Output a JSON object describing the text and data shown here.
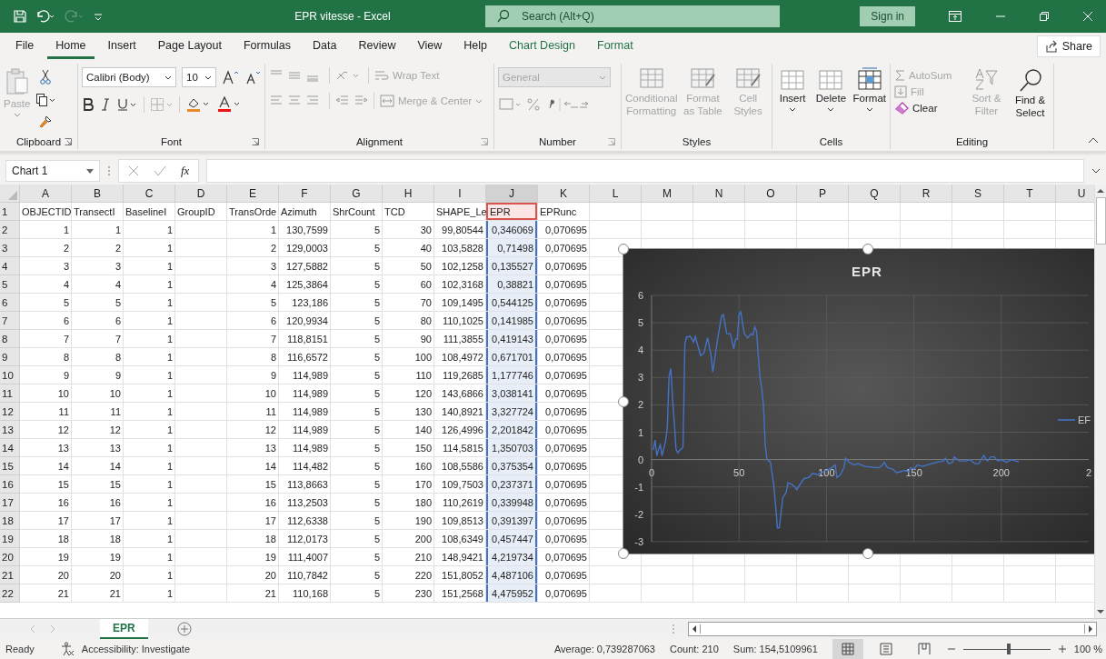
{
  "window": {
    "title": "EPR vitesse  -  Excel",
    "search": {
      "placeholder": "Search (Alt+Q)"
    },
    "sign_in": "Sign in"
  },
  "menu": [
    {
      "label": "File",
      "selected": false,
      "kind": "plain"
    },
    {
      "label": "Home",
      "selected": true,
      "kind": "plain"
    },
    {
      "label": "Insert",
      "selected": false,
      "kind": "plain"
    },
    {
      "label": "Page Layout",
      "selected": false,
      "kind": "plain"
    },
    {
      "label": "Formulas",
      "selected": false,
      "kind": "plain"
    },
    {
      "label": "Data",
      "selected": false,
      "kind": "plain"
    },
    {
      "label": "Review",
      "selected": false,
      "kind": "plain"
    },
    {
      "label": "View",
      "selected": false,
      "kind": "plain"
    },
    {
      "label": "Help",
      "selected": false,
      "kind": "plain"
    },
    {
      "label": "Chart Design",
      "selected": false,
      "kind": "contextual"
    },
    {
      "label": "Format",
      "selected": false,
      "kind": "contextual"
    }
  ],
  "share": "Share",
  "ribbon": {
    "clipboard": {
      "label": "Clipboard",
      "paste": {
        "label": "Paste",
        "disabled": true
      }
    },
    "font": {
      "label": "Font",
      "family": "Calibri (Body)",
      "size": "10"
    },
    "alignment": {
      "label": "Alignment",
      "wrap_text": {
        "label": "Wrap Text",
        "disabled": true
      },
      "merge_center": {
        "label": "Merge & Center",
        "disabled": true
      }
    },
    "number": {
      "label": "Number",
      "format": {
        "value": "General",
        "disabled": true
      }
    },
    "styles": {
      "label": "Styles",
      "buttons": [
        {
          "label": "Conditional Formatting",
          "disabled": true
        },
        {
          "label": "Format as Table",
          "disabled": true
        },
        {
          "label": "Cell Styles",
          "disabled": true
        }
      ]
    },
    "cells": {
      "label": "Cells",
      "buttons": [
        {
          "label": "Insert",
          "disabled": false
        },
        {
          "label": "Delete",
          "disabled": false
        },
        {
          "label": "Format",
          "disabled": false
        }
      ]
    },
    "editing": {
      "label": "Editing",
      "autosum": {
        "label": "AutoSum",
        "disabled": true
      },
      "fill": {
        "label": "Fill",
        "disabled": true
      },
      "clear": {
        "label": "Clear",
        "disabled": false
      },
      "sort_filter": {
        "label": "Sort & Filter",
        "disabled": true
      },
      "find_select": {
        "label": "Find & Select",
        "disabled": false
      }
    }
  },
  "formula_bar": {
    "name_box": "Chart 1",
    "fx": "fx"
  },
  "table": {
    "columns": [
      {
        "label": "A",
        "highlighted": false
      },
      {
        "label": "B",
        "highlighted": false
      },
      {
        "label": "C",
        "highlighted": false
      },
      {
        "label": "D",
        "highlighted": false
      },
      {
        "label": "E",
        "highlighted": false
      },
      {
        "label": "F",
        "highlighted": false
      },
      {
        "label": "G",
        "highlighted": false
      },
      {
        "label": "H",
        "highlighted": false
      },
      {
        "label": "I",
        "highlighted": false
      },
      {
        "label": "J",
        "highlighted": true
      },
      {
        "label": "K",
        "highlighted": false
      },
      {
        "label": "L",
        "highlighted": false
      },
      {
        "label": "M",
        "highlighted": false
      },
      {
        "label": "N",
        "highlighted": false
      },
      {
        "label": "O",
        "highlighted": false
      },
      {
        "label": "P",
        "highlighted": false
      },
      {
        "label": "Q",
        "highlighted": false
      },
      {
        "label": "R",
        "highlighted": false
      },
      {
        "label": "S",
        "highlighted": false
      },
      {
        "label": "T",
        "highlighted": false
      },
      {
        "label": "U",
        "highlighted": false
      }
    ],
    "rows": [
      {
        "number": "1",
        "cells": [
          "OBJECTID",
          "TransectI",
          "BaselineI",
          "GroupID",
          "TransOrde",
          "Azimuth",
          "ShrCount",
          "TCD",
          "SHAPE_Le",
          "EPR",
          "EPRunc"
        ]
      },
      {
        "number": "2",
        "cells": [
          "1",
          "1",
          "1",
          null,
          "1",
          "130,7599",
          "5",
          "30",
          "99,80544",
          "0,346069",
          "0,070695"
        ]
      },
      {
        "number": "3",
        "cells": [
          "2",
          "2",
          "1",
          null,
          "2",
          "129,0003",
          "5",
          "40",
          "103,5828",
          "0,71498",
          "0,070695"
        ]
      },
      {
        "number": "4",
        "cells": [
          "3",
          "3",
          "1",
          null,
          "3",
          "127,5882",
          "5",
          "50",
          "102,1258",
          "0,135527",
          "0,070695"
        ]
      },
      {
        "number": "5",
        "cells": [
          "4",
          "4",
          "1",
          null,
          "4",
          "125,3864",
          "5",
          "60",
          "102,3168",
          "0,38821",
          "0,070695"
        ]
      },
      {
        "number": "6",
        "cells": [
          "5",
          "5",
          "1",
          null,
          "5",
          "123,186",
          "5",
          "70",
          "109,1495",
          "0,544125",
          "0,070695"
        ]
      },
      {
        "number": "7",
        "cells": [
          "6",
          "6",
          "1",
          null,
          "6",
          "120,9934",
          "5",
          "80",
          "110,1025",
          "0,141985",
          "0,070695"
        ]
      },
      {
        "number": "8",
        "cells": [
          "7",
          "7",
          "1",
          null,
          "7",
          "118,8151",
          "5",
          "90",
          "111,3855",
          "0,419143",
          "0,070695"
        ]
      },
      {
        "number": "9",
        "cells": [
          "8",
          "8",
          "1",
          null,
          "8",
          "116,6572",
          "5",
          "100",
          "108,4972",
          "0,671701",
          "0,070695"
        ]
      },
      {
        "number": "10",
        "cells": [
          "9",
          "9",
          "1",
          null,
          "9",
          "114,989",
          "5",
          "110",
          "119,2685",
          "1,177746",
          "0,070695"
        ]
      },
      {
        "number": "11",
        "cells": [
          "10",
          "10",
          "1",
          null,
          "10",
          "114,989",
          "5",
          "120",
          "143,6866",
          "3,038141",
          "0,070695"
        ]
      },
      {
        "number": "12",
        "cells": [
          "11",
          "11",
          "1",
          null,
          "11",
          "114,989",
          "5",
          "130",
          "140,8921",
          "3,327724",
          "0,070695"
        ]
      },
      {
        "number": "13",
        "cells": [
          "12",
          "12",
          "1",
          null,
          "12",
          "114,989",
          "5",
          "140",
          "126,4996",
          "2,201842",
          "0,070695"
        ]
      },
      {
        "number": "14",
        "cells": [
          "13",
          "13",
          "1",
          null,
          "13",
          "114,989",
          "5",
          "150",
          "114,5815",
          "1,350703",
          "0,070695"
        ]
      },
      {
        "number": "15",
        "cells": [
          "14",
          "14",
          "1",
          null,
          "14",
          "114,482",
          "5",
          "160",
          "108,5586",
          "0,375354",
          "0,070695"
        ]
      },
      {
        "number": "16",
        "cells": [
          "15",
          "15",
          "1",
          null,
          "15",
          "113,8663",
          "5",
          "170",
          "109,7503",
          "0,237371",
          "0,070695"
        ]
      },
      {
        "number": "17",
        "cells": [
          "16",
          "16",
          "1",
          null,
          "16",
          "113,2503",
          "5",
          "180",
          "110,2619",
          "0,339948",
          "0,070695"
        ]
      },
      {
        "number": "18",
        "cells": [
          "17",
          "17",
          "1",
          null,
          "17",
          "112,6338",
          "5",
          "190",
          "109,8513",
          "0,391397",
          "0,070695"
        ]
      },
      {
        "number": "19",
        "cells": [
          "18",
          "18",
          "1",
          null,
          "18",
          "112,0173",
          "5",
          "200",
          "108,6349",
          "0,457447",
          "0,070695"
        ]
      },
      {
        "number": "20",
        "cells": [
          "19",
          "19",
          "1",
          null,
          "19",
          "111,4007",
          "5",
          "210",
          "148,9421",
          "4,219734",
          "0,070695"
        ]
      },
      {
        "number": "21",
        "cells": [
          "20",
          "20",
          "1",
          null,
          "20",
          "110,7842",
          "5",
          "220",
          "151,8052",
          "4,487106",
          "0,070695"
        ]
      },
      {
        "number": "22",
        "cells": [
          "21",
          "21",
          "1",
          null,
          "21",
          "110,168",
          "5",
          "230",
          "151,2568",
          "4,475952",
          "0,070695"
        ]
      }
    ]
  },
  "chart": {
    "selected": true,
    "edge_label": "2",
    "chart_data": {
      "type": "line",
      "title": "EPR",
      "x": [
        1,
        2,
        3,
        4,
        5,
        6,
        7,
        8,
        9,
        10,
        11,
        12,
        13,
        14,
        15,
        16,
        17,
        18,
        19,
        20,
        21,
        22,
        24,
        25,
        28,
        30,
        32,
        34,
        35,
        38,
        40,
        41,
        43,
        45,
        47,
        48,
        49,
        50,
        51,
        53,
        55,
        57,
        58,
        59,
        60,
        61,
        62,
        63,
        64,
        65,
        66,
        68,
        70,
        72,
        73,
        75,
        77,
        78,
        80,
        82,
        83,
        85,
        87,
        90,
        92,
        95,
        98,
        100,
        103,
        105,
        106,
        108,
        110,
        111,
        113,
        116,
        118,
        122,
        126,
        130,
        132,
        133,
        135,
        138,
        140,
        145,
        147,
        148,
        150,
        152,
        155,
        160,
        163,
        167,
        168,
        170,
        172,
        173,
        176,
        180,
        182,
        185,
        187,
        190,
        192,
        194,
        196,
        198,
        200,
        203,
        206,
        208,
        210
      ],
      "series": [
        {
          "name": "EF",
          "color": "#4472c4",
          "values": [
            0.35,
            0.71,
            0.14,
            0.39,
            0.54,
            0.14,
            0.42,
            0.67,
            1.18,
            3.04,
            3.33,
            2.2,
            1.35,
            0.38,
            0.24,
            0.34,
            0.39,
            0.46,
            4.22,
            4.49,
            4.48,
            4.51,
            4.3,
            4.5,
            3.8,
            3.9,
            4.45,
            3.8,
            3.2,
            4.5,
            5.25,
            5.3,
            4.6,
            4.6,
            4.05,
            4.4,
            4.4,
            5.3,
            5.4,
            4.6,
            4.45,
            4.6,
            4.55,
            4.85,
            4.7,
            3.8,
            3.0,
            2.6,
            2.0,
            0.5,
            0.0,
            -0.1,
            -1.0,
            -2.5,
            -2.5,
            -1.4,
            -1.2,
            -0.85,
            -0.9,
            -1.0,
            -1.1,
            -0.9,
            -0.7,
            -0.65,
            -0.5,
            -0.55,
            -0.45,
            -0.4,
            -0.3,
            -0.2,
            -0.65,
            -0.55,
            -0.3,
            0.05,
            -0.1,
            -0.2,
            -0.15,
            -0.25,
            -0.28,
            -0.3,
            -0.2,
            -0.1,
            -0.3,
            -0.35,
            -0.48,
            -0.4,
            -0.45,
            -0.3,
            -0.35,
            -0.2,
            -0.25,
            -0.15,
            -0.1,
            -0.05,
            0.05,
            -0.15,
            -0.1,
            0.1,
            -0.05,
            -0.05,
            0,
            -0.15,
            -0.15,
            0.15,
            -0.05,
            0.1,
            0.1,
            -0.05,
            0,
            -0.1,
            0,
            -0.05,
            -0.08
          ]
        }
      ],
      "grid": true,
      "xlim": [
        0,
        250
      ],
      "ylim": [
        -3,
        6
      ],
      "xticks": [
        0,
        50,
        100,
        150,
        200
      ],
      "yticks": [
        -3,
        -2,
        -1,
        0,
        1,
        2,
        3,
        4,
        5,
        6
      ]
    }
  },
  "sheet_tabs": [
    {
      "label": "EPR",
      "selected": true
    }
  ],
  "status_bar": {
    "mode": "Ready",
    "accessibility": "Accessibility: Investigate",
    "average": "Average: 0,739287063",
    "count": "Count: 210",
    "sum": "Sum: 154,5109961",
    "views": [
      {
        "selected": true
      },
      {
        "selected": false
      },
      {
        "selected": false
      }
    ],
    "zoom": {
      "level": 0.52,
      "label": "100 %"
    }
  }
}
